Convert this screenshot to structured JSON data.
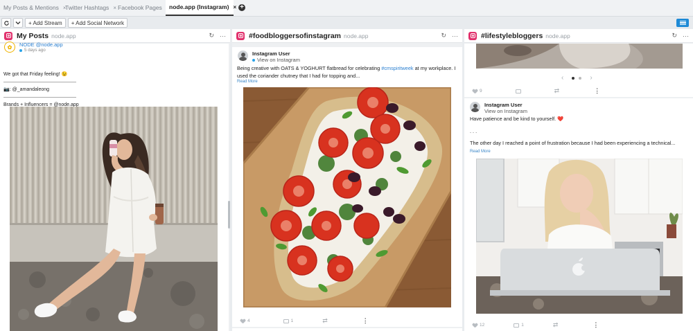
{
  "tabs": [
    {
      "label": "My Posts & Mentions",
      "close": "×",
      "active": false
    },
    {
      "label": "Twitter Hashtags",
      "close": "×",
      "active": false
    },
    {
      "label": "Facebook Pages",
      "close": "×",
      "active": false
    },
    {
      "label": "node.app (Instagram)",
      "close": "×",
      "active": true
    }
  ],
  "toolbar": {
    "add_stream": "+ Add Stream",
    "add_network": "+ Add Social Network",
    "refresh_icon": "refresh-icon",
    "chevron_icon": "chevron-down-icon",
    "menu_icon": "hamburger-menu-icon"
  },
  "columns": [
    {
      "title": "My Posts",
      "subtitle": "node.app",
      "post": {
        "author": "NODE @node.app",
        "time": "5 days ago",
        "lines": [
          "We got that Friday feeling! 😉",
          "———————————————",
          "📷: @_amandaleong",
          "———————————————",
          "Brands + Influencers = @node.app"
        ]
      }
    },
    {
      "title": "#foodbloggersofinstagram",
      "subtitle": "node.app",
      "post": {
        "author": "Instagram User",
        "link": "View on Instagram",
        "text_before": "Being creative with OATS & YOGHURT flatbread for celebrating ",
        "hashtag": "#cmspiritweek",
        "text_after": " at my workplace. I used the coriander chutney that I had for topping and...",
        "read_more": "Read More",
        "likes": "4",
        "comments": "1"
      }
    },
    {
      "title": "#lifestylebloggers",
      "subtitle": "node.app",
      "prev_post": {
        "likes": "9"
      },
      "carousel": {
        "prev": "‹",
        "next": "›"
      },
      "post": {
        "author": "Instagram User",
        "link": "View on Instagram",
        "line1": "Have patience and be kind to yourself. ❤️",
        "line2": ". . .",
        "line3": "The other day I reached a point of frustration because I had been experiencing a technical...",
        "read_more": "Read More",
        "likes": "12",
        "comments": "1"
      }
    }
  ],
  "colors": {
    "accent": "#1e8ad6",
    "instagram": "#e1306c",
    "link": "#2a7fd0"
  }
}
